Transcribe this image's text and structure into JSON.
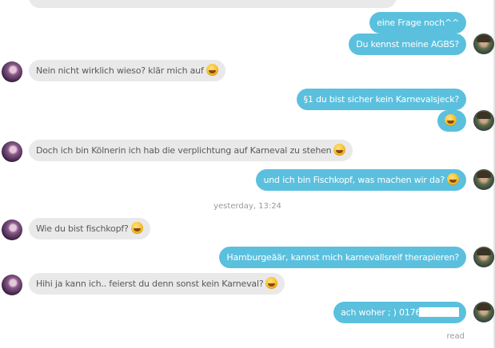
{
  "chat": {
    "timestamp": "yesterday, 13:24",
    "read_label": "read",
    "messages": [
      {
        "text": "eine Frage noch^^"
      },
      {
        "text": "Du kennst meine AGBS?"
      },
      {
        "text": "Nein nicht wirklich wieso? klär mich auf"
      },
      {
        "text": "§1 du bist sicher kein Karnevalsjeck?"
      },
      {
        "text": ""
      },
      {
        "text": "Doch ich bin Kölnerin ich hab die verplichtung auf Karneval zu stehen"
      },
      {
        "text": "und ich bin Fischkopf, was machen wir da?"
      },
      {
        "text": "Wie du bist fischkopf?"
      },
      {
        "text": "Hamburgeäär, kannst mich karnevallsreif therapieren?"
      },
      {
        "text": "Hihi ja kann ich.. feierst du denn sonst kein Karneval?"
      },
      {
        "text": "ach woher ; ) 0176-"
      }
    ]
  },
  "colors": {
    "outgoing_bubble": "#5bc0de",
    "incoming_bubble": "#e9e9e9",
    "muted_text": "#9a9a9a"
  },
  "icons": {
    "emoji": "grinning-face-icon",
    "user_avatar": "avatar-own",
    "contact_avatar": "avatar-contact"
  }
}
